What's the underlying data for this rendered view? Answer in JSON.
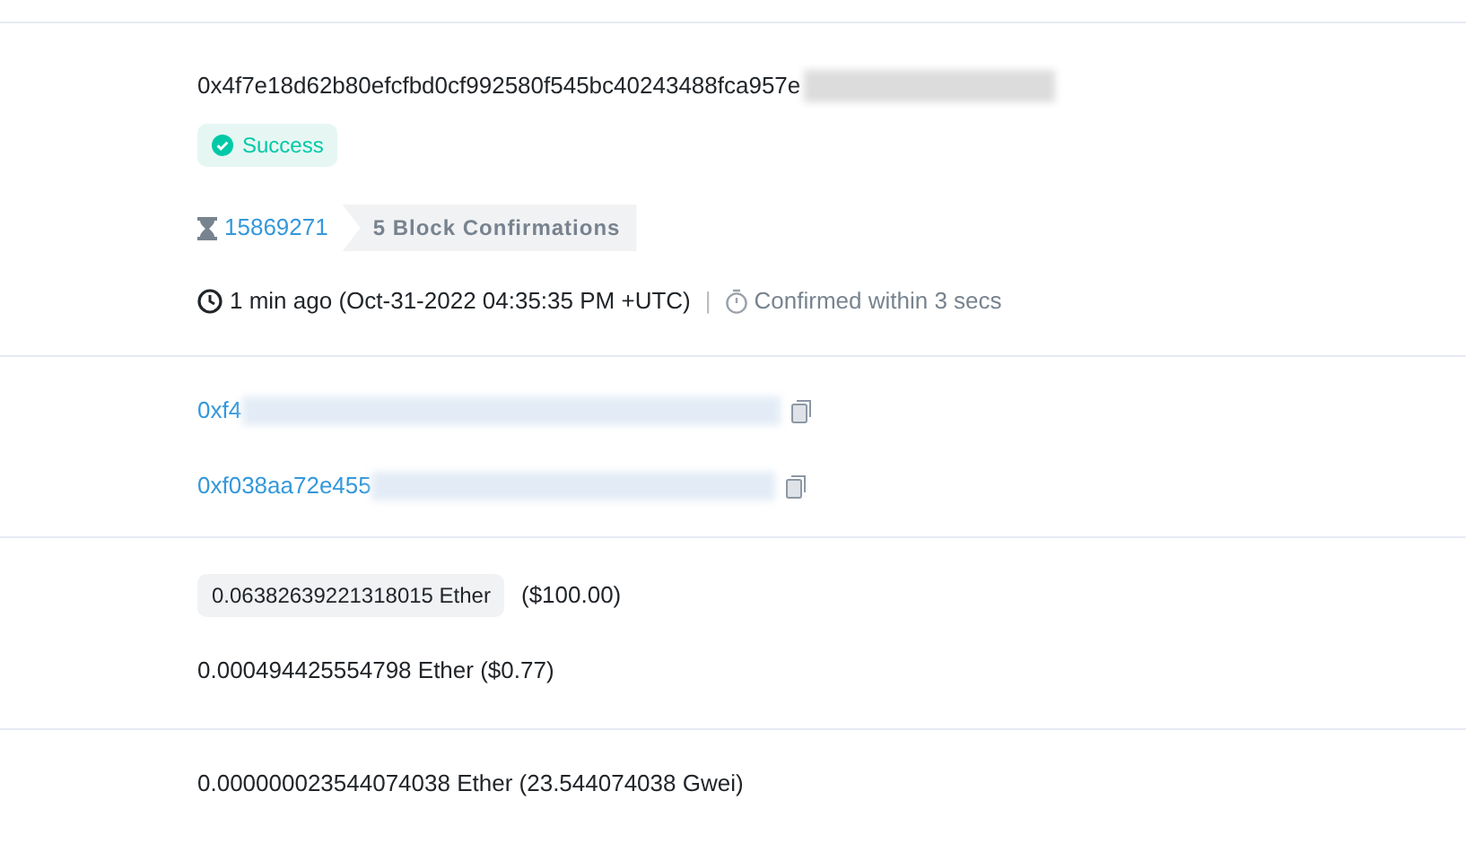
{
  "transaction_hash": "0x4f7e18d62b80efcfbd0cf992580f545bc40243488fca957e",
  "status": {
    "label": "Success",
    "kind": "success"
  },
  "block": {
    "number": "15869271",
    "confirmations": "5 Block Confirmations"
  },
  "timestamp": {
    "age": "1 min ago (Oct-31-2022 04:35:35 PM +UTC)",
    "separator": "|",
    "confirmed": "Confirmed within 3 secs"
  },
  "addresses": [
    {
      "value": "0xf4"
    },
    {
      "value": "0xf038aa72e455"
    }
  ],
  "value": {
    "amount": "0.06382639221318015 Ether",
    "usd": "($100.00)"
  },
  "fee": "0.000494425554798 Ether ($0.77)",
  "gas_price": "0.000000023544074038 Ether (23.544074038 Gwei)"
}
